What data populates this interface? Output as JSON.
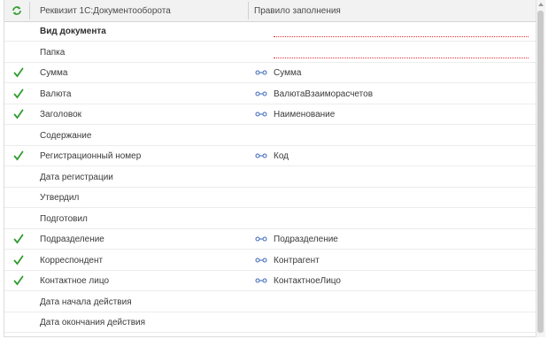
{
  "header": {
    "col_requisite": "Реквизит 1С:Документооборота",
    "col_rule": "Правило заполнения"
  },
  "colors": {
    "check": "#2e9c2e",
    "link_icon": "#3a68b8",
    "required_line": "#e03030"
  },
  "rows": [
    {
      "requisite": "Вид документа",
      "rule": "",
      "checked": false,
      "bold": true,
      "required": true
    },
    {
      "requisite": "Папка",
      "rule": "",
      "checked": false,
      "bold": false,
      "required": true
    },
    {
      "requisite": "Сумма",
      "rule": "Сумма",
      "checked": true,
      "bold": false,
      "required": false
    },
    {
      "requisite": "Валюта",
      "rule": "ВалютаВзаиморасчетов",
      "checked": true,
      "bold": false,
      "required": false
    },
    {
      "requisite": "Заголовок",
      "rule": "Наименование",
      "checked": true,
      "bold": false,
      "required": false
    },
    {
      "requisite": "Содержание",
      "rule": "",
      "checked": false,
      "bold": false,
      "required": false
    },
    {
      "requisite": "Регистрационный номер",
      "rule": "Код",
      "checked": true,
      "bold": false,
      "required": false
    },
    {
      "requisite": "Дата регистрации",
      "rule": "",
      "checked": false,
      "bold": false,
      "required": false
    },
    {
      "requisite": "Утвердил",
      "rule": "",
      "checked": false,
      "bold": false,
      "required": false
    },
    {
      "requisite": "Подготовил",
      "rule": "",
      "checked": false,
      "bold": false,
      "required": false
    },
    {
      "requisite": "Подразделение",
      "rule": "Подразделение",
      "checked": true,
      "bold": false,
      "required": false
    },
    {
      "requisite": "Корреспондент",
      "rule": "Контрагент",
      "checked": true,
      "bold": false,
      "required": false
    },
    {
      "requisite": "Контактное лицо",
      "rule": "КонтактноеЛицо",
      "checked": true,
      "bold": false,
      "required": false
    },
    {
      "requisite": "Дата начала действия",
      "rule": "",
      "checked": false,
      "bold": false,
      "required": false
    },
    {
      "requisite": "Дата окончания действия",
      "rule": "",
      "checked": false,
      "bold": false,
      "required": false
    }
  ]
}
